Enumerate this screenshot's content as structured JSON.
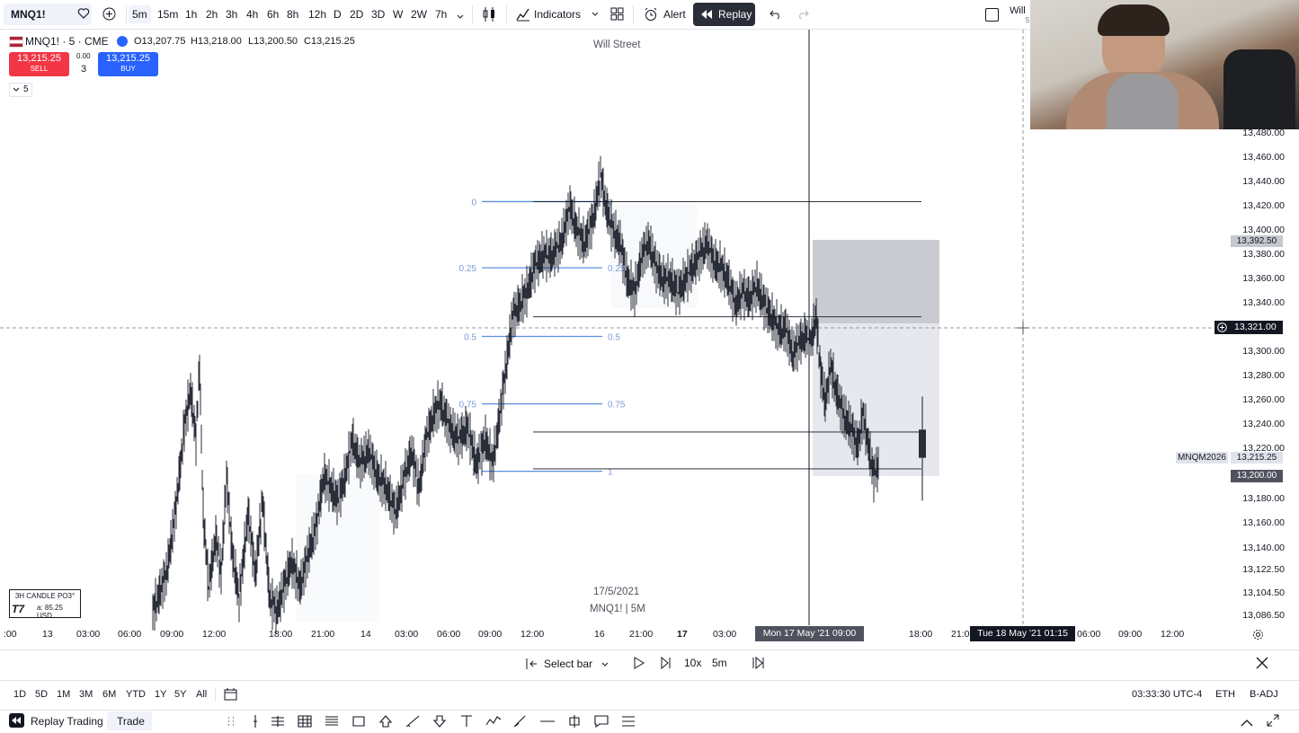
{
  "toolbar": {
    "symbol": "MNQ1!",
    "intervals": [
      "5m",
      "15m",
      "1h",
      "2h",
      "3h",
      "4h",
      "6h",
      "8h",
      "12h",
      "D",
      "2D",
      "3D",
      "W",
      "2W",
      "7h"
    ],
    "active_interval": "5m",
    "indicators_label": "Indicators",
    "alert_label": "Alert",
    "replay_label": "Replay",
    "user_label": "Will",
    "user_label_2": "S"
  },
  "chart": {
    "symbol_line": "MNQ1! · 5 · CME",
    "open": "O13,207.75",
    "high": "H13,218.00",
    "low": "L13,200.50",
    "close": "C13,215.25",
    "sell_price": "13,215.25",
    "sell_label": "SELL",
    "buy_price": "13,215.25",
    "buy_label": "BUY",
    "spread": "0.00",
    "qty": "3",
    "indicator_count": "5",
    "watermark_top": "Will Street",
    "watermark_date": "17/5/2021",
    "watermark_symbol": "MNQ1! | 5M",
    "indicator_badge": "3H CANDLE PO3°",
    "indicator_badge_sub": "a: 85.25 USD",
    "fib_levels": [
      {
        "label": "0",
        "value": 13424.0
      },
      {
        "label": "0.25",
        "value": 13370.0
      },
      {
        "label": "0.5",
        "value": 13314.0
      },
      {
        "label": "0.75",
        "value": 13259.0
      },
      {
        "label": "1",
        "value": 13204.0
      }
    ],
    "crosshair_price": "13,321.00",
    "tag_13392": "13,392.50",
    "tag_symbol": "MNQM2026",
    "tag_last": "13,215.25",
    "tag_13200": "13,200.00",
    "price_axis": [
      "13,480.00",
      "13,460.00",
      "13,440.00",
      "13,420.00",
      "13,400.00",
      "13,380.00",
      "13,360.00",
      "13,340.00",
      "13,300.00",
      "13,280.00",
      "13,260.00",
      "13,240.00",
      "13,220.00",
      "13,180.00",
      "13,160.00",
      "13,140.00",
      "13,122.50",
      "13,104.50",
      "13,086.50"
    ],
    "time_axis": [
      ":00",
      "13",
      "03:00",
      "06:00",
      "09:00",
      "12:00",
      "18:00",
      "21:00",
      "14",
      "03:00",
      "06:00",
      "09:00",
      "12:00",
      "16",
      "21:00",
      "17",
      "03:00",
      "18:00",
      "21:0",
      "06:00",
      "09:00",
      "12:00"
    ],
    "time_cursor_1": "Mon 17 May '21   09:00",
    "time_cursor_2": "Tue 18 May '21   01:15"
  },
  "replay": {
    "select_bar": "Select bar",
    "speed": "10x",
    "interval": "5m"
  },
  "ranges": {
    "items": [
      "1D",
      "5D",
      "1M",
      "3M",
      "6M",
      "YTD",
      "1Y",
      "5Y",
      "All"
    ],
    "clock": "03:33:30 UTC-4",
    "session": "ETH",
    "adj": "B-ADJ"
  },
  "bottom": {
    "replay_trading": "Replay Trading",
    "trade": "Trade"
  }
}
